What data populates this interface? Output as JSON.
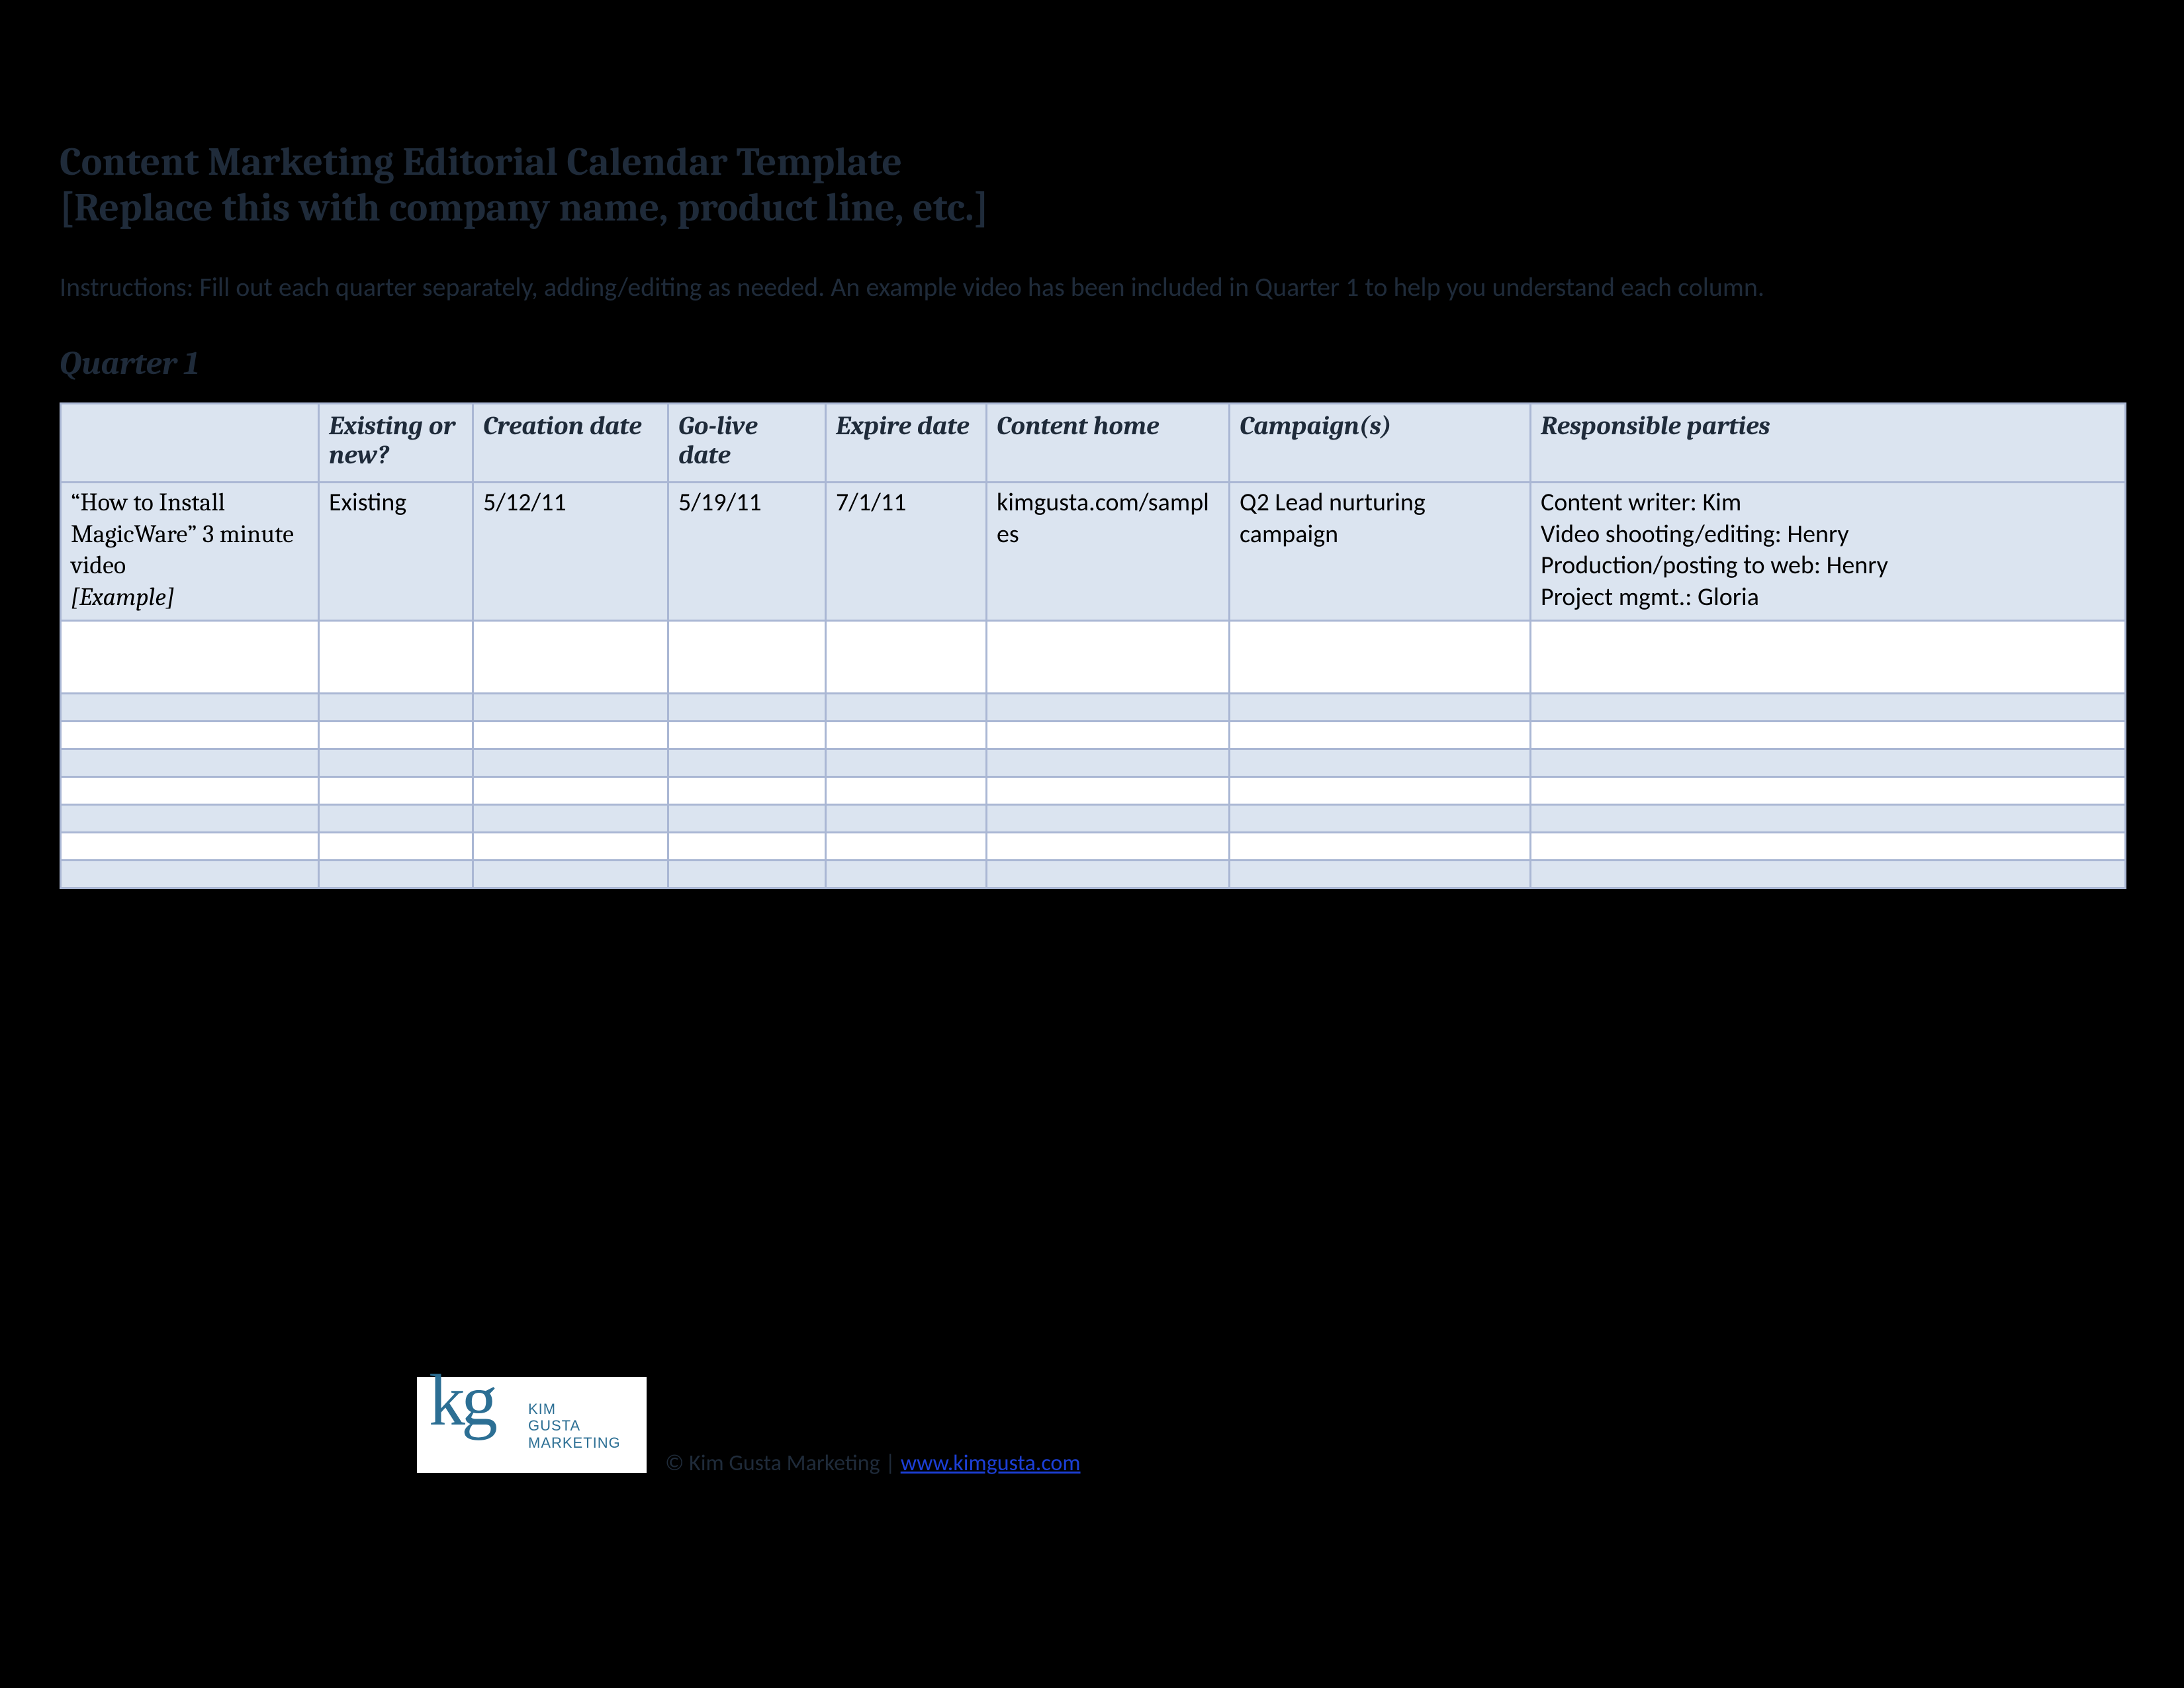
{
  "title": {
    "line1": "Content Marketing Editorial Calendar Template",
    "line2": "[Replace this with company name, product line, etc.]"
  },
  "intro": "Instructions: Fill out each quarter separately, adding/editing as needed.  An example video has been included in Quarter 1 to help you understand each column.",
  "section_header": "Quarter 1",
  "columns": [
    "",
    "Existing or new?",
    "Creation date",
    "Go-live date",
    "Expire date",
    "Content home",
    "Campaign(s)",
    "Responsible parties"
  ],
  "row_example": {
    "label_line1": "“How to Install MagicWare” 3 minute video",
    "label_line2": "[Example]",
    "existing": "Existing",
    "creation": "5/12/11",
    "golive": "5/19/11",
    "expire": "7/1/11",
    "home": "kimgusta.com/samples",
    "campaign": "Q2 Lead nurturing campaign",
    "responsible": [
      "Content writer: Kim",
      "Video shooting/editing: Henry",
      "Production/posting to web:  Henry",
      "Project mgmt.: Gloria"
    ]
  },
  "logo": {
    "mark": "kg",
    "line1": "KIM",
    "line2": "GUSTA",
    "line3": "MARKETING"
  },
  "copyright": {
    "prefix": "© Kim Gusta Marketing | ",
    "link_text": "www.kimgusta.com",
    "link_href": "http://www.kimgusta.com"
  }
}
